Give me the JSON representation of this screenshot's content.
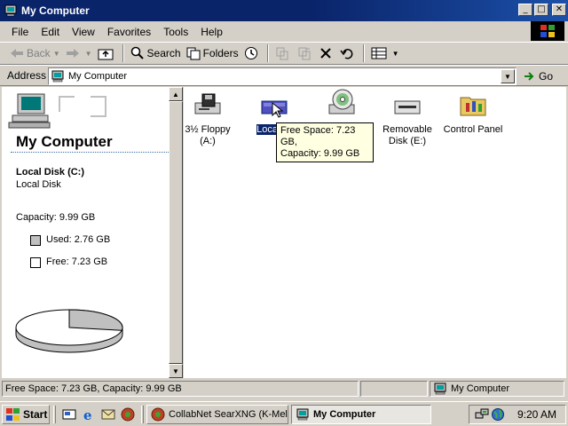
{
  "window": {
    "title": "My Computer"
  },
  "menubar": {
    "items": [
      "File",
      "Edit",
      "View",
      "Favorites",
      "Tools",
      "Help"
    ]
  },
  "toolbar": {
    "back": "Back",
    "search": "Search",
    "folders": "Folders"
  },
  "address": {
    "label": "Address",
    "value": "My Computer",
    "go": "Go"
  },
  "leftpane": {
    "title": "My Computer",
    "drive_name": "Local Disk (C:)",
    "drive_type": "Local Disk",
    "capacity": "Capacity: 9.99 GB",
    "used": "Used: 2.76 GB",
    "free": "Free: 7.23 GB",
    "used_fraction": 0.276
  },
  "drives": [
    {
      "label1": "3½ Floppy",
      "label2": "(A:)"
    },
    {
      "label1": "Local Di",
      "label2": ""
    },
    {
      "label1": "",
      "label2": ""
    },
    {
      "label1": "Removable",
      "label2": "Disk (E:)"
    },
    {
      "label1": "Control Panel",
      "label2": ""
    }
  ],
  "tooltip": {
    "line1": "Free Space: 7.23 GB,",
    "line2": "Capacity: 9.99 GB"
  },
  "statusbar": {
    "text": "Free Space: 7.23 GB, Capacity: 9.99 GB",
    "zone": "My Computer"
  },
  "taskbar": {
    "start": "Start",
    "tasks": [
      "CollabNet SearXNG (K-Mel...",
      "My Computer"
    ],
    "clock": "9:20 AM"
  },
  "colors": {
    "title_bar": "#0a246a",
    "window_face": "#d4d0c8",
    "selection": "#0a246a",
    "tooltip_bg": "#ffffe1"
  }
}
